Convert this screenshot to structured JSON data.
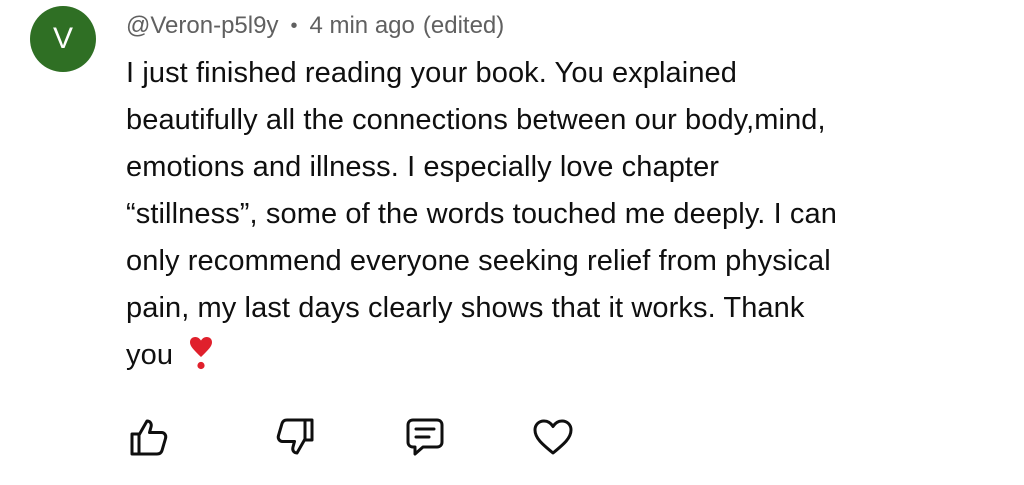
{
  "comment": {
    "avatar_letter": "V",
    "avatar_color": "#2f6f24",
    "username": "@Veron-p5l9y",
    "separator": "•",
    "time": "4 min ago",
    "edited": "(edited)",
    "text": "I just finished reading your book. You explained\nbeautifully all the connections between our body,mind,\nemotions and illness. I especially love chapter\n“stillness”, some of the words touched me deeply. I can\nonly recommend everyone seeking  relief from physical\npain, my last days clearly shows that it works. Thank\nyou",
    "emoji": "heavy-heart-exclamation-emoji"
  },
  "actions": [
    {
      "icon": "thumbs-up-icon"
    },
    {
      "icon": "thumbs-down-icon"
    },
    {
      "icon": "reply-icon"
    },
    {
      "icon": "heart-icon"
    }
  ]
}
